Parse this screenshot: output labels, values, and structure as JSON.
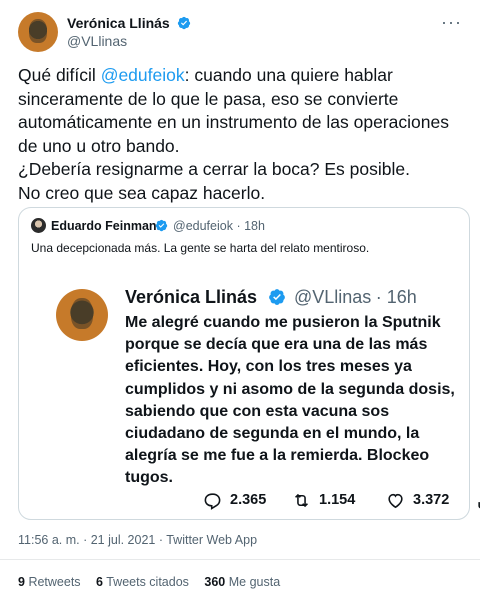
{
  "tweet": {
    "author": {
      "name": "Verónica Llinás",
      "handle": "@VLlinas",
      "verified": true
    },
    "more_icon": "more-horizontal-icon",
    "text_parts": [
      "Qué difícil ",
      "@edufeiok",
      ": cuando una quiere hablar sinceramente de lo que le pasa, eso se convierte automáticamente en un instrumento de las operaciones de uno u otro bando.",
      "¿Debería resignarme a cerrar la boca? Es posible.",
      "No creo que sea capaz hacerlo."
    ],
    "timestamp": "11:56 a. m. · 21 jul. 2021 · Twitter Web App"
  },
  "quote": {
    "author": {
      "name": "Eduardo Feinmann",
      "handle": "@edufeiok",
      "time": "18h",
      "verified": true
    },
    "text": "Una decepcionada más. La gente se harta del relato mentiroso.",
    "embedded": {
      "author": {
        "name": "Verónica Llinás",
        "handle": "@VLlinas",
        "time": "16h",
        "verified": true
      },
      "text": "Me alegré cuando me pusieron la Sputnik porque se decía que era una de las más eficientes. Hoy, con los tres meses ya cumplidos y ni asomo de la segunda dosis, sabiendo que con esta vacuna sos ciudadano de segunda en el mundo, la alegría se me fue a la remierda. Blockeo tugos.",
      "actions": {
        "replies": "2.365",
        "retweets": "1.154",
        "likes": "3.372"
      }
    }
  },
  "stats": {
    "retweets_count": "9",
    "retweets_label": "Retweets",
    "quotes_count": "6",
    "quotes_label": "Tweets citados",
    "likes_count": "360",
    "likes_label": "Me gusta"
  },
  "colors": {
    "accent": "#1d9bf0",
    "text": "#0f1419",
    "muted": "#536471",
    "border": "#cfd9de"
  }
}
